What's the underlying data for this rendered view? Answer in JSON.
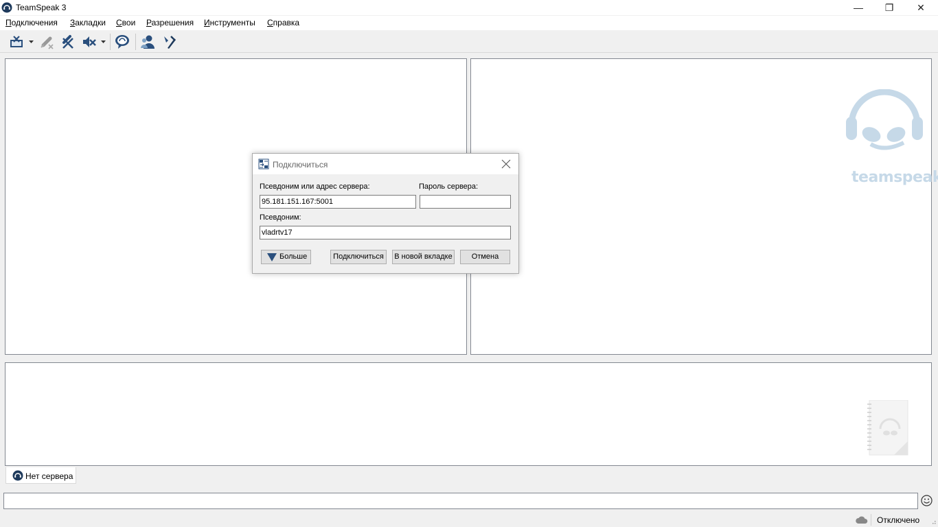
{
  "window": {
    "title": "TeamSpeak 3",
    "controls": {
      "minimize": "—",
      "maximize": "❐",
      "close": "✕"
    }
  },
  "menu": [
    {
      "first": "П",
      "rest": "одключения"
    },
    {
      "first": "З",
      "rest": "акладки"
    },
    {
      "first": "С",
      "rest": "вои"
    },
    {
      "first": "Р",
      "rest": "азрешения"
    },
    {
      "first": "И",
      "rest": "нструменты"
    },
    {
      "first": "С",
      "rest": "правка"
    }
  ],
  "toolbar": {
    "icons": [
      "disconnect-icon",
      "microphone-muted-icon",
      "headphones-muted-icon",
      "speaker-muted-icon",
      "chat-icon",
      "contacts-icon",
      "tools-icon"
    ]
  },
  "tabs": [
    {
      "label": "Нет сервера"
    }
  ],
  "status": {
    "connection": "Отключено"
  },
  "logo": {
    "text": "teamspeak"
  },
  "dialog": {
    "title": "Подключиться",
    "address_label": "Псевдоним или адрес сервера:",
    "address_value": "95.181.151.167:5001",
    "password_label": "Пароль сервера:",
    "password_value": "",
    "nickname_label": "Псевдоним:",
    "nickname_value": "vladrtv17",
    "more_label": "Больше",
    "connect_label": "Подключиться",
    "new_tab_label": "В новой вкладке",
    "cancel_label": "Отмена"
  },
  "colors": {
    "accent": "#2a4f7d",
    "logo": "#c6d9e8",
    "panel_border": "#828790"
  }
}
